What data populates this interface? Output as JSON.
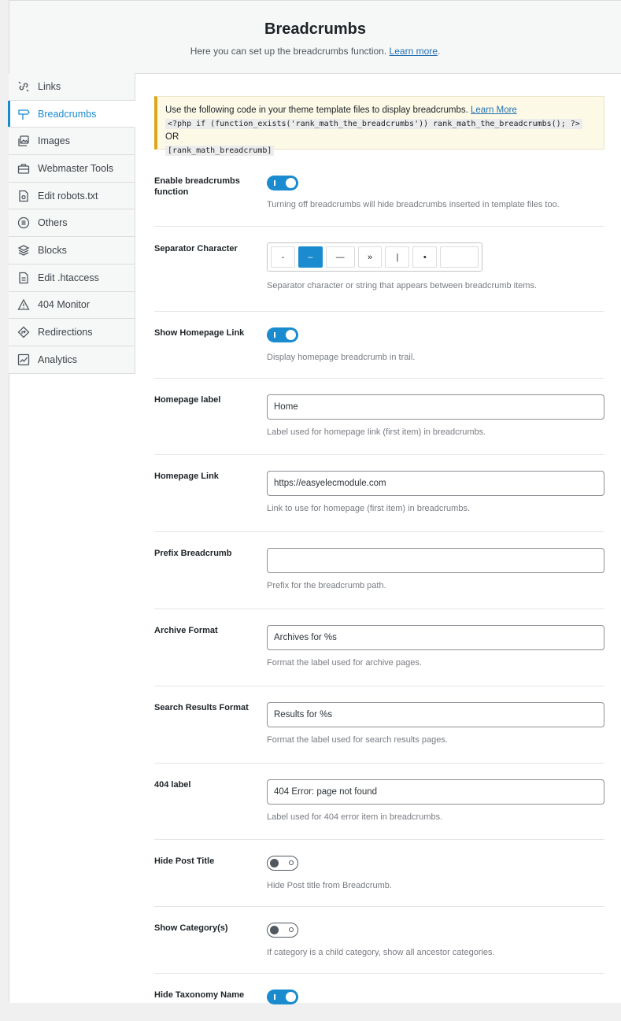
{
  "header": {
    "title": "Breadcrumbs",
    "subtitle": "Here you can set up the breadcrumbs function.",
    "learn_more": "Learn more"
  },
  "sidebar": {
    "items": [
      {
        "label": "Links",
        "icon": "links-icon"
      },
      {
        "label": "Breadcrumbs",
        "icon": "breadcrumbs-icon",
        "active": true
      },
      {
        "label": "Images",
        "icon": "images-icon"
      },
      {
        "label": "Webmaster Tools",
        "icon": "webmaster-tools-icon"
      },
      {
        "label": "Edit robots.txt",
        "icon": "robots-icon"
      },
      {
        "label": "Others",
        "icon": "others-icon"
      },
      {
        "label": "Blocks",
        "icon": "blocks-icon"
      },
      {
        "label": "Edit .htaccess",
        "icon": "htaccess-icon"
      },
      {
        "label": "404 Monitor",
        "icon": "warning-icon"
      },
      {
        "label": "Redirections",
        "icon": "redirections-icon"
      },
      {
        "label": "Analytics",
        "icon": "analytics-icon"
      }
    ]
  },
  "notice": {
    "text": "Use the following code in your theme template files to display breadcrumbs.",
    "link": "Learn More",
    "code1": "<?php if (function_exists('rank_math_the_breadcrumbs')) rank_math_the_breadcrumbs(); ?>",
    "or": "OR",
    "code2": "[rank_math_breadcrumb]"
  },
  "settings": {
    "enable": {
      "label": "Enable breadcrumbs function",
      "desc": "Turning off breadcrumbs will hide breadcrumbs inserted in template files too.",
      "on": true
    },
    "separator": {
      "label": "Separator Character",
      "options": [
        "-",
        "–",
        "—",
        "»",
        "|",
        "•"
      ],
      "selected": "–",
      "desc": "Separator character or string that appears between breadcrumb items."
    },
    "show_home": {
      "label": "Show Homepage Link",
      "desc": "Display homepage breadcrumb in trail.",
      "on": true
    },
    "home_label": {
      "label": "Homepage label",
      "value": "Home",
      "desc": "Label used for homepage link (first item) in breadcrumbs."
    },
    "home_link": {
      "label": "Homepage Link",
      "value": "https://easyelecmodule.com",
      "desc": "Link to use for homepage (first item) in breadcrumbs."
    },
    "prefix": {
      "label": "Prefix Breadcrumb",
      "value": "",
      "desc": "Prefix for the breadcrumb path."
    },
    "archive": {
      "label": "Archive Format",
      "value": "Archives for %s",
      "desc": "Format the label used for archive pages."
    },
    "search": {
      "label": "Search Results Format",
      "value": "Results for %s",
      "desc": "Format the label used for search results pages."
    },
    "notfound": {
      "label": "404 label",
      "value": "404 Error: page not found",
      "desc": "Label used for 404 error item in breadcrumbs."
    },
    "hide_title": {
      "label": "Hide Post Title",
      "desc": "Hide Post title from Breadcrumb.",
      "on": false
    },
    "show_cat": {
      "label": "Show Category(s)",
      "desc": "If category is a child category, show all ancestor categories.",
      "on": false
    },
    "hide_tax": {
      "label": "Hide Taxonomy Name",
      "on": true
    }
  },
  "colors": {
    "accent": "#1a8bce",
    "notice_border": "#dba617"
  }
}
